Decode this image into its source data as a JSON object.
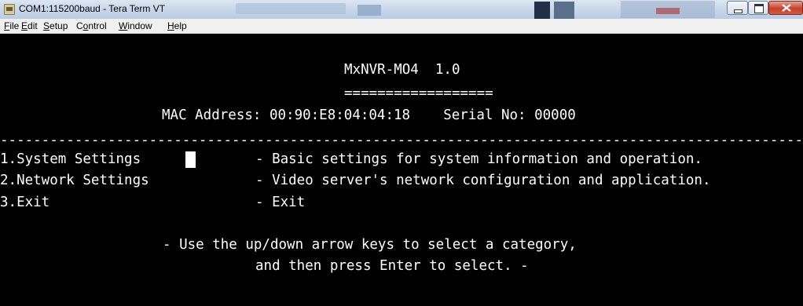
{
  "window": {
    "title": "COM1:115200baud - Tera Term VT",
    "app_icon": "teraterm-app-icon"
  },
  "menubar": {
    "file": {
      "ul": "F",
      "rest": "ile"
    },
    "edit": {
      "ul": "E",
      "rest": "dit"
    },
    "setup": {
      "ul": "S",
      "rest": "etup"
    },
    "control_pre": "C",
    "control_ul": "o",
    "control_rest": "ntrol",
    "window": {
      "ul": "W",
      "rest": "indow"
    },
    "help": {
      "ul": "H",
      "rest": "elp"
    }
  },
  "terminal": {
    "header_title": "MxNVR-MO4  1.0",
    "header_underline": "==================",
    "mac_line": "MAC Address: 00:90:E8:04:04:18    Serial No: 00000",
    "separator": "------------------------------------------------------------------------------------------------------",
    "menu": [
      {
        "label": "1.System Settings",
        "desc": "- Basic settings for system information and operation."
      },
      {
        "label": "2.Network Settings",
        "desc": "- Video server's network configuration and application."
      },
      {
        "label": "3.Exit",
        "desc": "- Exit"
      }
    ],
    "instruction_1": "- Use the up/down arrow keys to select a category,",
    "instruction_2": "and then press Enter to select. -"
  },
  "colors": {
    "terminal_bg": "#000000",
    "terminal_fg": "#ffffff",
    "titlebar": "#c9d7ea",
    "close_button": "#c6412d"
  }
}
